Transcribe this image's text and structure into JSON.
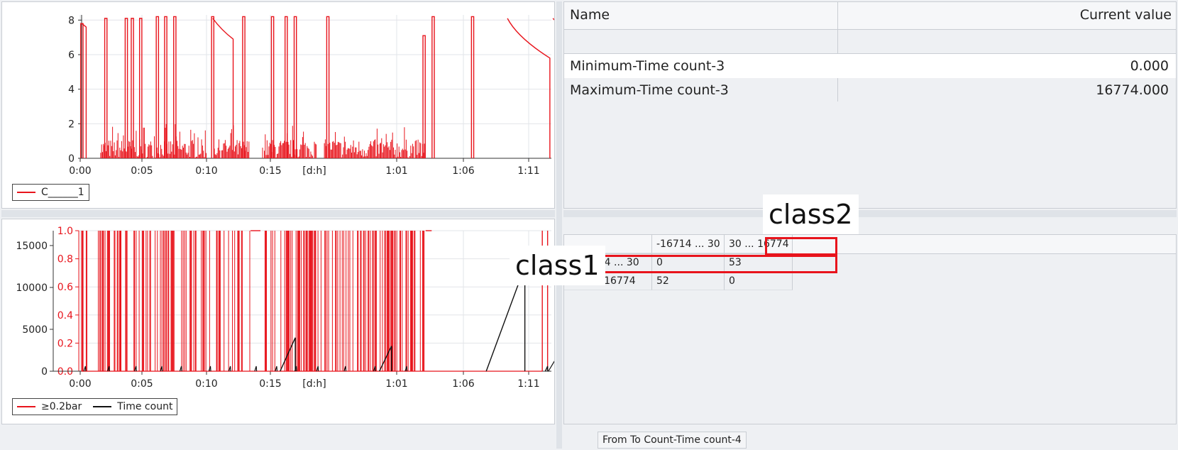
{
  "chart_data": [
    {
      "type": "line",
      "x_unit": "[d:h]",
      "x_ticks": [
        "0:00",
        "0:05",
        "0:10",
        "0:15",
        "1:01",
        "1:06",
        "1:11"
      ],
      "y_ticks": [
        0,
        2,
        4,
        6,
        8
      ],
      "ylim": [
        0,
        8.3
      ],
      "series": [
        {
          "name": "C______1",
          "color": "#e8141c",
          "peaks": [
            {
              "x": 0.04,
              "y": 7.8
            },
            {
              "x": 3.2,
              "y": 8.1
            },
            {
              "x": 5.9,
              "y": 8.1
            },
            {
              "x": 6.7,
              "y": 8.1
            },
            {
              "x": 7.8,
              "y": 8.1
            },
            {
              "x": 10.0,
              "y": 8.2
            },
            {
              "x": 11.1,
              "y": 8.2
            },
            {
              "x": 12.3,
              "y": 8.2
            },
            {
              "x": 17.3,
              "y": 8.2
            },
            {
              "x": 21.4,
              "y": 8.2
            },
            {
              "x": 25.2,
              "y": 8.2
            },
            {
              "x": 27.0,
              "y": 8.2
            },
            {
              "x": 28.2,
              "y": 8.2
            },
            {
              "x": 32.5,
              "y": 8.2
            },
            {
              "x": 45.2,
              "y": 7.1
            },
            {
              "x": 46.4,
              "y": 8.2
            },
            {
              "x": 51.6,
              "y": 8.2
            }
          ],
          "noise_level_max": 2.0
        }
      ],
      "legend": "bottom-left"
    },
    {
      "type": "line",
      "x_unit": "[d:h]",
      "x_ticks": [
        "0:00",
        "0:05",
        "0:10",
        "0:15",
        "1:01",
        "1:06",
        "1:11"
      ],
      "y_left_ticks": [
        0,
        5000,
        10000,
        15000
      ],
      "y_right_ticks": [
        "0.0",
        "0.2",
        "0.4",
        "0.6",
        "0.8",
        "1.0"
      ],
      "y_left_lim": [
        0,
        16774
      ],
      "y_right_lim": [
        0,
        1.0
      ],
      "series": [
        {
          "name": "≥0.2bar",
          "color": "#e8141c",
          "axis": "right"
        },
        {
          "name": "Time count",
          "color": "#111111",
          "axis": "left"
        }
      ],
      "ramps": [
        {
          "x0": 26.2,
          "x1": 28.2,
          "y1": 4000
        },
        {
          "x0": 39.3,
          "x1": 40.9,
          "y1": 3000
        },
        {
          "x0": 53.4,
          "x1": 58.5,
          "y1": 12500
        },
        {
          "x0": 61.2,
          "x1": 61.5,
          "y1": 600
        }
      ],
      "legend": "bottom-left"
    }
  ],
  "stats_table": {
    "headers": {
      "name": "Name",
      "value": "Current value"
    },
    "rows": [
      {
        "name": "Minimum-Time count-3",
        "value": "0.000"
      },
      {
        "name": "Maximum-Time count-3",
        "value": "16774.000"
      }
    ]
  },
  "matrix": {
    "col_headers": [
      "-16714 ... 30",
      "30 ... 16774"
    ],
    "rows": [
      {
        "label": "-16714 ... 30",
        "values": [
          "0",
          "53"
        ]
      },
      {
        "label": "30 ... 16774",
        "values": [
          "52",
          "0"
        ]
      }
    ],
    "tab_label": "From To Count-Time count-4"
  },
  "annotations": {
    "class1": "class1",
    "class2": "class2",
    "highlight_color": "#e8141c"
  }
}
